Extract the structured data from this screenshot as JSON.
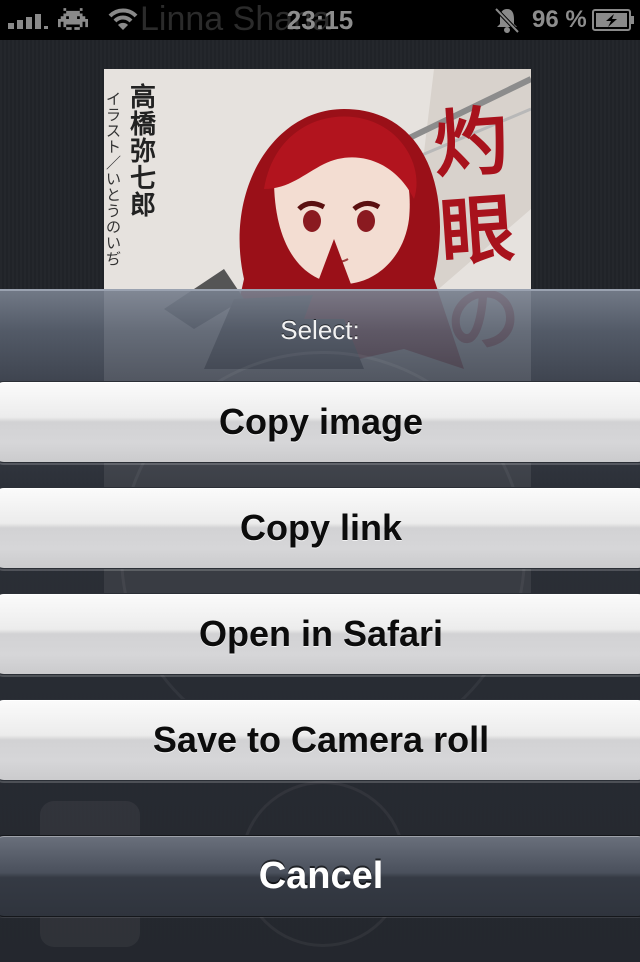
{
  "status_bar": {
    "time": "23:15",
    "battery_percent": "96 %",
    "ghost_text": "Linna Shana",
    "icons": [
      "signal-icon",
      "space-invader-icon",
      "wifi-icon",
      "mute-bell-icon",
      "battery-charging-icon"
    ]
  },
  "cover": {
    "author": "高橋弥七郎",
    "illustrator": "イラスト／いとうのいぢ",
    "title": "灼眼の"
  },
  "sheet": {
    "title": "Select:",
    "buttons": {
      "copy_image": "Copy image",
      "copy_link": "Copy link",
      "open_in_safari": "Open in Safari",
      "save_to_camera_roll": "Save to Camera roll",
      "cancel": "Cancel"
    }
  }
}
